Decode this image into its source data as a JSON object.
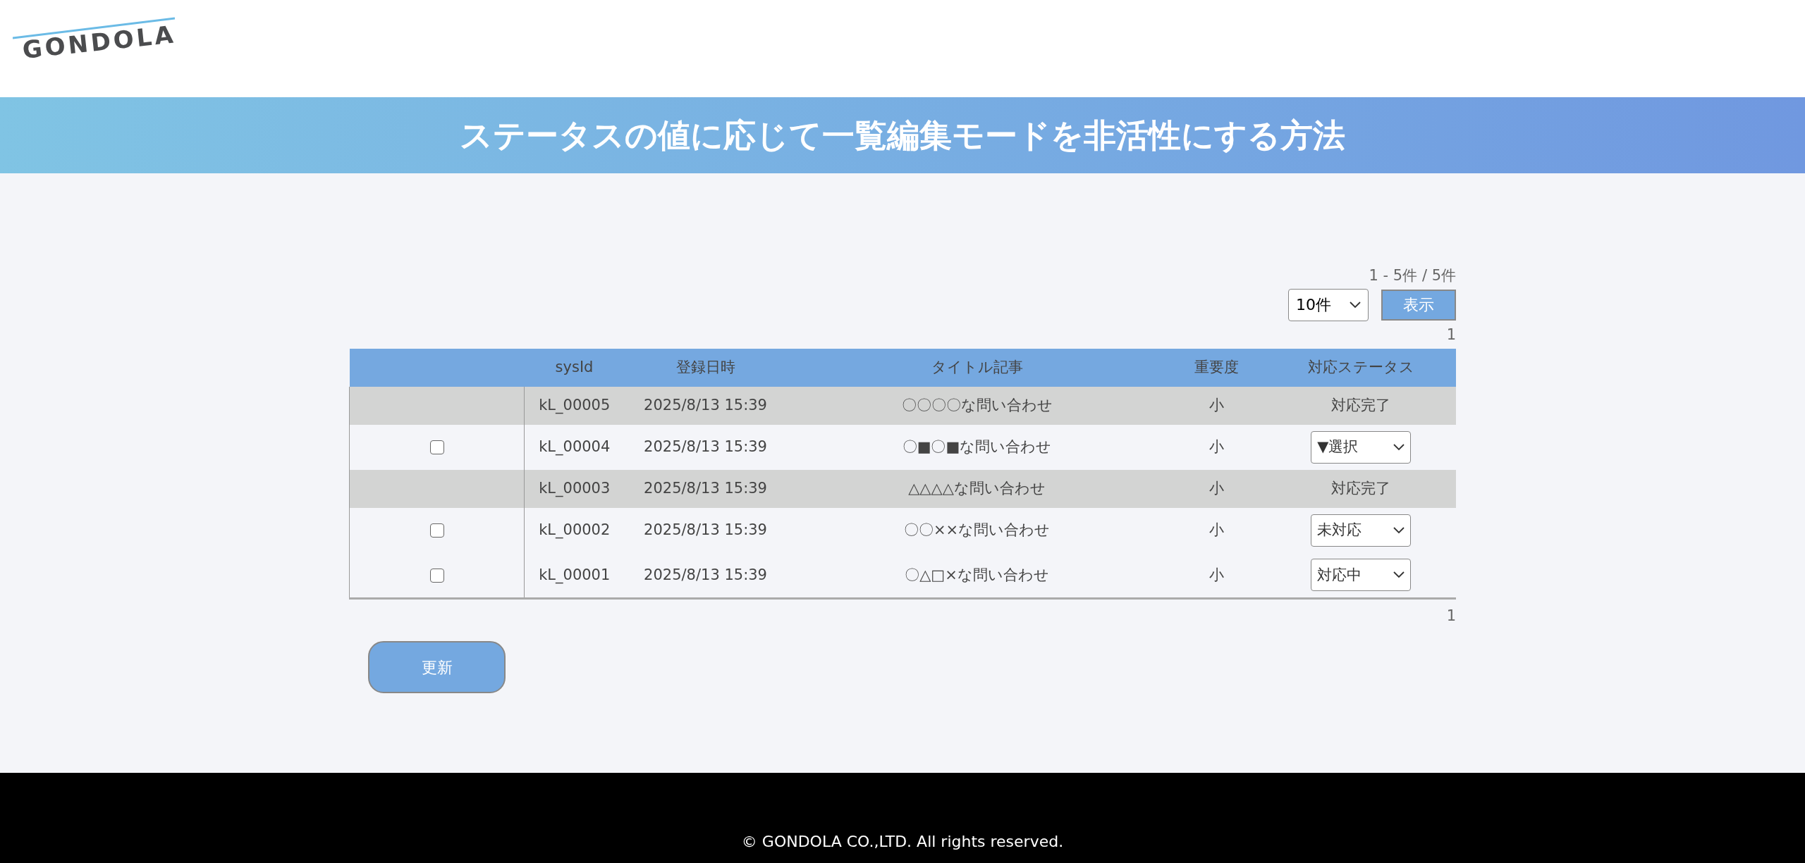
{
  "logo": {
    "text": "GONDOLA"
  },
  "banner": {
    "title": "ステータスの値に応じて一覧編集モードを非活性にする方法"
  },
  "pager_top": {
    "range": "1 - 5件 / 5件",
    "per_page": "10件",
    "show_button": "表示",
    "page": "1"
  },
  "table": {
    "columns": [
      "",
      "sysId",
      "登録日時",
      "タイトル記事",
      "重要度",
      "対応ステータス"
    ],
    "rows": [
      {
        "kind": "locked",
        "sys_id": "kL_00005",
        "date": "2025/8/13 15:39",
        "title": "〇〇〇〇な問い合わせ",
        "importance": "小",
        "status": "対応完了"
      },
      {
        "kind": "editable",
        "checked": false,
        "sys_id": "kL_00004",
        "date": "2025/8/13 15:39",
        "title": "〇■〇■な問い合わせ",
        "importance": "小",
        "status": "▼選択"
      },
      {
        "kind": "locked",
        "sys_id": "kL_00003",
        "date": "2025/8/13 15:39",
        "title": "△△△△な問い合わせ",
        "importance": "小",
        "status": "対応完了"
      },
      {
        "kind": "editable",
        "checked": false,
        "sys_id": "kL_00002",
        "date": "2025/8/13 15:39",
        "title": "〇〇××な問い合わせ",
        "importance": "小",
        "status": "未対応"
      },
      {
        "kind": "editable",
        "checked": false,
        "sys_id": "kL_00001",
        "date": "2025/8/13 15:39",
        "title": "〇△□×な問い合わせ",
        "importance": "小",
        "status": "対応中"
      }
    ]
  },
  "pager_bottom": {
    "page": "1"
  },
  "update_button": "更新",
  "footer": {
    "copyright": "© GONDOLA CO.,LTD. All rights reserved."
  }
}
